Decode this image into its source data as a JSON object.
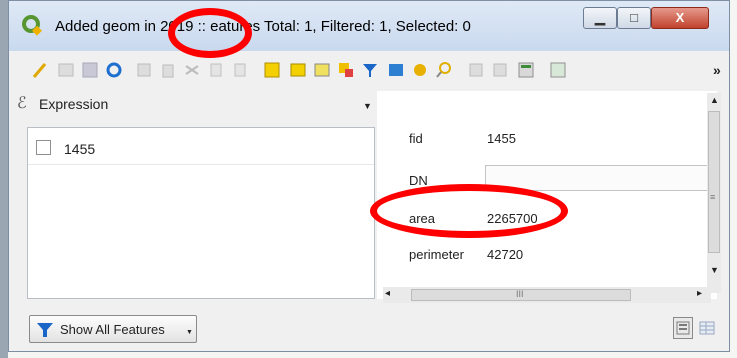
{
  "window": {
    "title": "Added geom in 2019 :: Features Total: 1, Filtered: 1, Selected: 0",
    "title_visible": {
      "pre": "Added geom in",
      "marked": "2019",
      "post": ":: eatures Total: 1, Filtered: 1, Selected: 0"
    }
  },
  "toolbar": {
    "icons": [
      "toggle-editing",
      "multi-edit",
      "save-edits",
      "reload",
      "add-feature",
      "delete-feature",
      "cut",
      "copy",
      "paste",
      "expression-select",
      "select-all",
      "invert-selection",
      "move-selection-top",
      "filter-selected",
      "pan-to-selected",
      "zoom-to-selected",
      "zoom-map",
      "new-field",
      "delete-field",
      "open-field-calculator",
      "conditional-formatting"
    ],
    "overflow_label": "»"
  },
  "expression": {
    "label": "Expression"
  },
  "feature_list": [
    {
      "id": "1455",
      "checked": false
    }
  ],
  "attributes": [
    {
      "name": "fid",
      "value": "1455"
    },
    {
      "name": "DN",
      "value": ""
    },
    {
      "name": "area",
      "value": "2265700"
    },
    {
      "name": "perimeter",
      "value": "42720"
    }
  ],
  "footer": {
    "show_all_label": "Show All Features"
  },
  "scrollbar": {
    "grip_glyph": "≡",
    "h_grip_glyph": "III"
  },
  "colors": {
    "accent_title": "#c9d9ee",
    "annotation": "#ff0000",
    "close_button": "#c1422e"
  }
}
